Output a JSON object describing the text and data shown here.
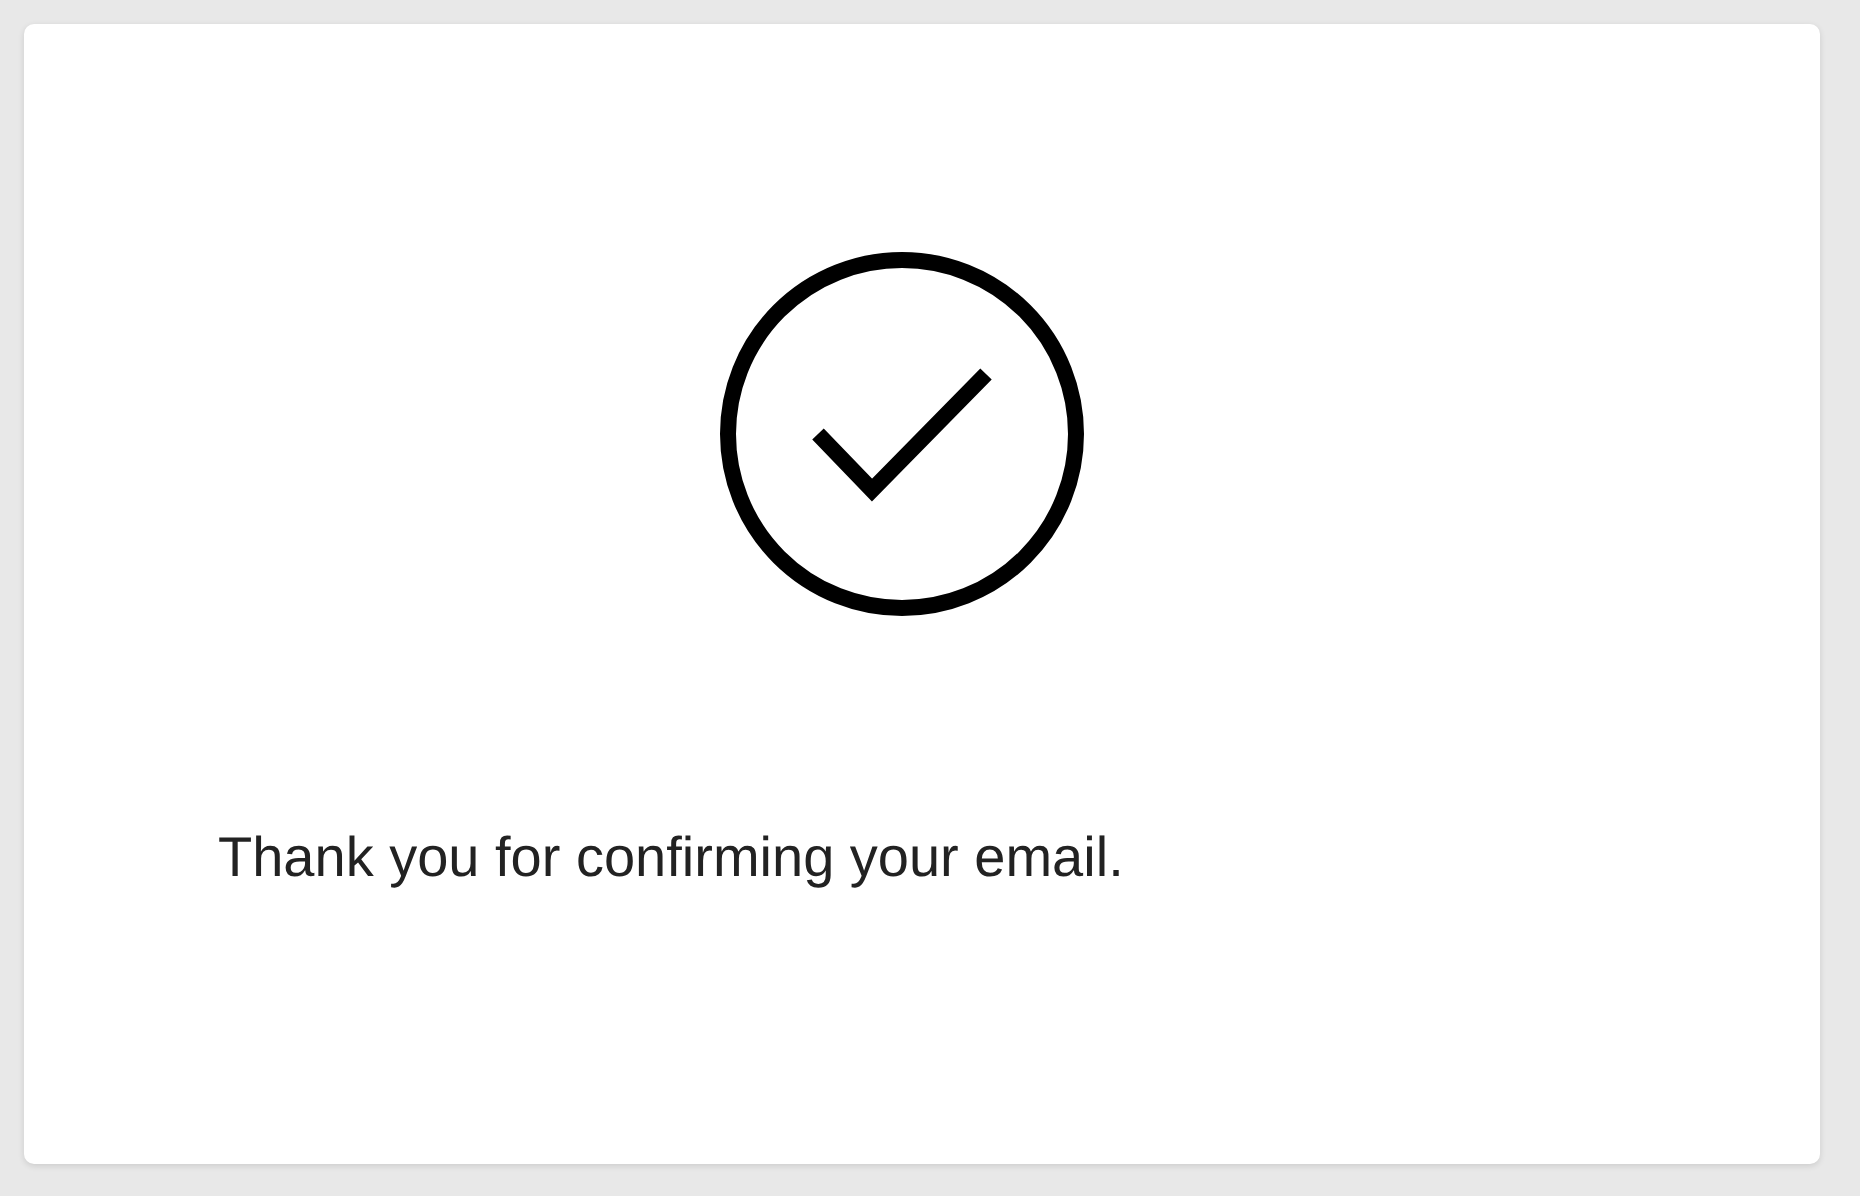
{
  "message": "Thank you for confirming your email."
}
